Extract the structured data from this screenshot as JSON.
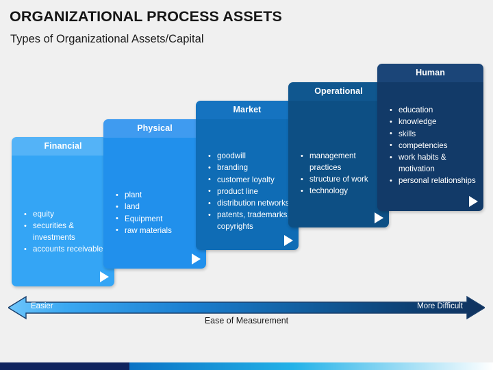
{
  "slide": {
    "title": "ORGANIZATIONAL PROCESS ASSETS",
    "subtitle": "Types of Organizational Assets/Capital",
    "background_color": "#f0f0f0"
  },
  "cards": [
    {
      "id": "financial",
      "header": "Financial",
      "header_color": "#54b3f7",
      "body_color": "#34a5f5",
      "arrow_icon": "play-arrow-icon",
      "items": [
        "equity",
        "securities & investments",
        "accounts receivable"
      ]
    },
    {
      "id": "physical",
      "header": "Physical",
      "header_color": "#3f9bf0",
      "body_color": "#2190ec",
      "arrow_icon": "play-arrow-icon",
      "items": [
        "plant",
        "land",
        "Equipment",
        "raw materials"
      ]
    },
    {
      "id": "market",
      "header": "Market",
      "header_color": "#1573c0",
      "body_color": "#0f6cb5",
      "arrow_icon": "play-arrow-icon",
      "items": [
        "goodwill",
        "branding",
        "customer loyalty",
        "product line",
        "distribution networks",
        "patents, trademarks, copyrights"
      ]
    },
    {
      "id": "operational",
      "header": "Operational",
      "header_color": "#10578f",
      "body_color": "#0d4f84",
      "arrow_icon": "play-arrow-icon",
      "items": [
        "management practices",
        "structure of work",
        "technology"
      ]
    },
    {
      "id": "human",
      "header": "Human",
      "header_color": "#1b4578",
      "body_color": "#123a68",
      "arrow_icon": "play-arrow-icon",
      "items": [
        "education",
        "knowledge",
        "skills",
        "competencies",
        "work habits & motivation",
        "personal relationships"
      ]
    }
  ],
  "scale": {
    "left_label": "Easier",
    "right_label": "More Difficult",
    "caption": "Ease of Measurement",
    "gradient_start": "#4db8f7",
    "gradient_end": "#123a68",
    "outline_color": "#1b3f6b"
  },
  "bottom_strip": {
    "navy_color": "#10245e",
    "gradient_start": "#0a72c4",
    "gradient_mid": "#23b2e8",
    "gradient_end": "#ffffff"
  }
}
